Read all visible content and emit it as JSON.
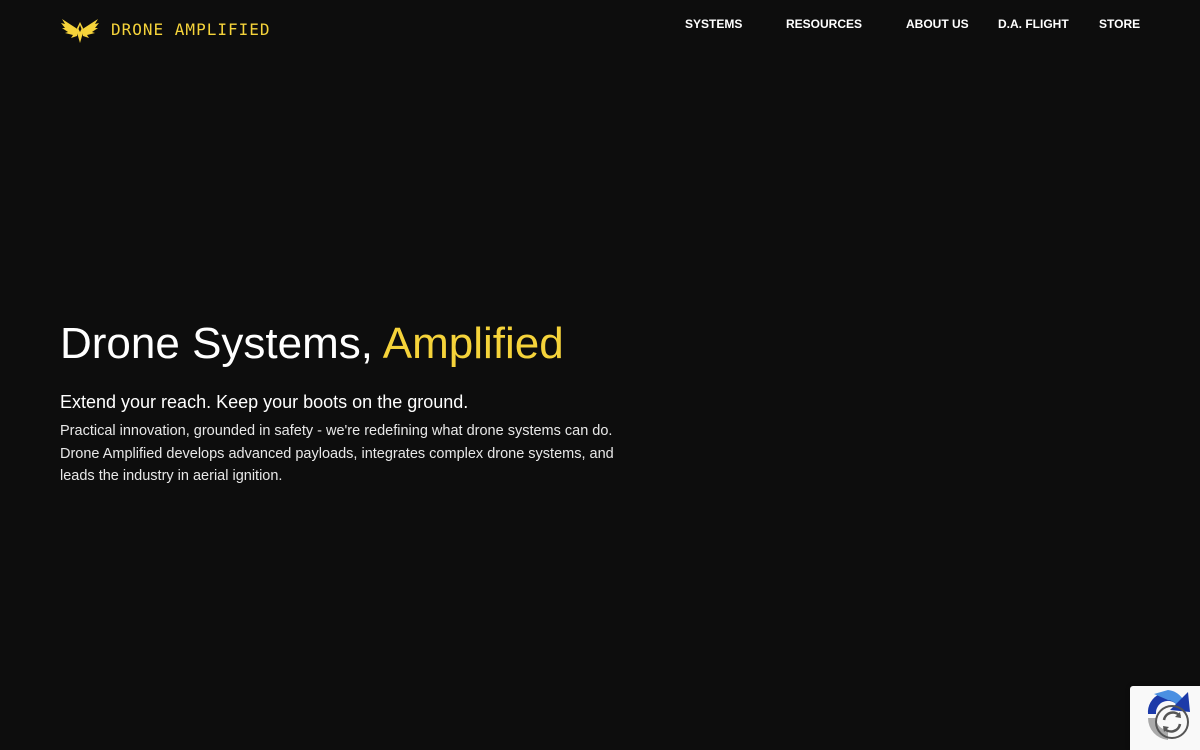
{
  "brand": {
    "name": "DRONE AMPLIFIED",
    "logo_icon": "phoenix-logo-icon",
    "accent_color": "#f5d33a",
    "background_color": "#0d0d0d"
  },
  "nav": {
    "items": [
      {
        "label": "SYSTEMS"
      },
      {
        "label": "RESOURCES"
      },
      {
        "label": "ABOUT US"
      },
      {
        "label": "D.A. FLIGHT"
      },
      {
        "label": "STORE"
      }
    ]
  },
  "hero": {
    "title_main": "Drone Systems, ",
    "title_accent": "Amplified",
    "subtitle": "Extend your reach. Keep your boots on the ground.",
    "body": "Practical innovation, grounded in safety - we're redefining what drone systems can do. Drone Amplified develops advanced payloads, integrates complex drone systems, and leads the industry in aerial ignition."
  },
  "recaptcha": {
    "icon": "recaptcha-icon"
  }
}
